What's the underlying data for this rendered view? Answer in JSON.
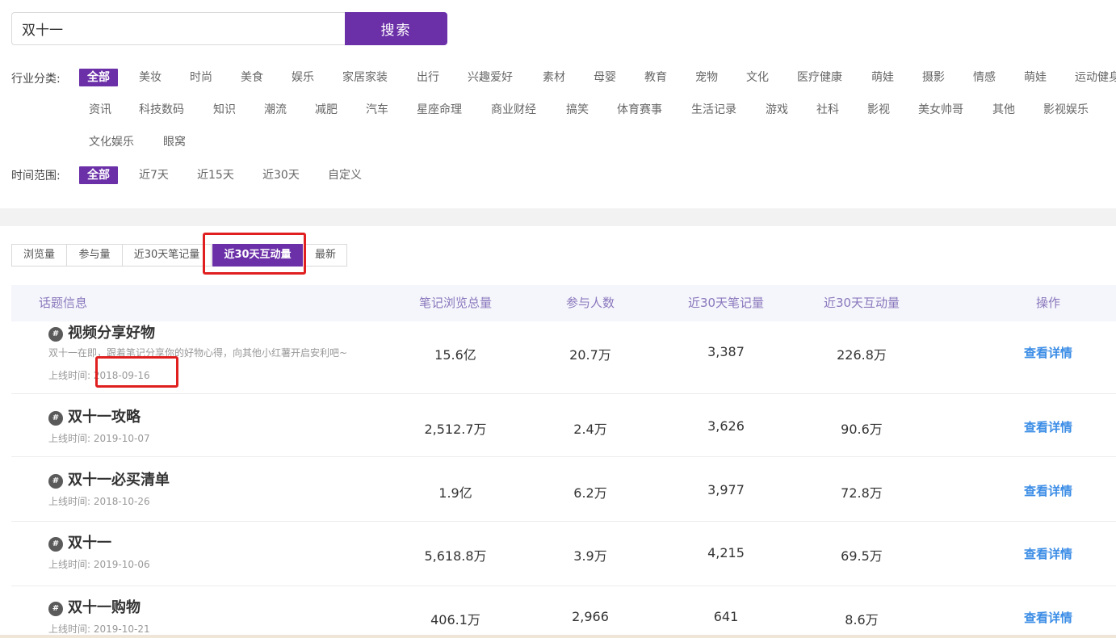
{
  "search": {
    "value": "双十一",
    "button_label": "搜索"
  },
  "filters": {
    "industry": {
      "label": "行业分类:",
      "items": [
        {
          "label": "全部",
          "active": true
        },
        {
          "label": "美妆"
        },
        {
          "label": "时尚"
        },
        {
          "label": "美食"
        },
        {
          "label": "娱乐"
        },
        {
          "label": "家居家装"
        },
        {
          "label": "出行"
        },
        {
          "label": "兴趣爱好"
        },
        {
          "label": "素材"
        },
        {
          "label": "母婴"
        },
        {
          "label": "教育"
        },
        {
          "label": "宠物"
        },
        {
          "label": "文化"
        },
        {
          "label": "医疗健康"
        },
        {
          "label": "萌娃"
        },
        {
          "label": "摄影"
        },
        {
          "label": "情感"
        },
        {
          "label": "萌娃"
        },
        {
          "label": "运动健身"
        },
        {
          "label": "资讯"
        },
        {
          "label": "科技数码"
        },
        {
          "label": "知识"
        },
        {
          "label": "潮流"
        },
        {
          "label": "减肥"
        },
        {
          "label": "汽车"
        },
        {
          "label": "星座命理"
        },
        {
          "label": "商业财经"
        },
        {
          "label": "搞笑"
        },
        {
          "label": "体育赛事"
        },
        {
          "label": "生活记录"
        },
        {
          "label": "游戏"
        },
        {
          "label": "社科"
        },
        {
          "label": "影视"
        },
        {
          "label": "美女帅哥"
        },
        {
          "label": "其他"
        },
        {
          "label": "影视娱乐"
        },
        {
          "label": "文化娱乐"
        },
        {
          "label": "眼窝"
        }
      ]
    },
    "time_range": {
      "label": "时间范围:",
      "items": [
        {
          "label": "全部",
          "active": true
        },
        {
          "label": "近7天"
        },
        {
          "label": "近15天"
        },
        {
          "label": "近30天"
        },
        {
          "label": "自定义"
        }
      ]
    }
  },
  "sort_tabs": [
    {
      "label": "浏览量"
    },
    {
      "label": "参与量"
    },
    {
      "label": "近30天笔记量"
    },
    {
      "label": "近30天互动量",
      "active": true
    },
    {
      "label": "最新"
    }
  ],
  "table": {
    "headers": {
      "topic": "话题信息",
      "views": "笔记浏览总量",
      "participants": "参与人数",
      "notes_30d": "近30天笔记量",
      "interactions_30d": "近30天互动量",
      "action": "操作"
    },
    "time_prefix": "上线时间:",
    "rows": [
      {
        "title": "视频分享好物",
        "desc": "双十一在即，跟着笔记分享你的好物心得，向其他小红薯开启安利吧~",
        "date": "2018-09-16",
        "views": "15.6亿",
        "participants": "20.7万",
        "notes_30d": "3,387",
        "interactions_30d": "226.8万",
        "action": "查看详情"
      },
      {
        "title": "双十一攻略",
        "date": "2019-10-07",
        "views": "2,512.7万",
        "participants": "2.4万",
        "notes_30d": "3,626",
        "interactions_30d": "90.6万",
        "action": "查看详情"
      },
      {
        "title": "双十一必买清单",
        "date": "2018-10-26",
        "views": "1.9亿",
        "participants": "6.2万",
        "notes_30d": "3,977",
        "interactions_30d": "72.8万",
        "action": "查看详情"
      },
      {
        "title": "双十一",
        "date": "2019-10-06",
        "views": "5,618.8万",
        "participants": "3.9万",
        "notes_30d": "4,215",
        "interactions_30d": "69.5万",
        "action": "查看详情"
      },
      {
        "title": "双十一购物",
        "date": "2019-10-21",
        "views": "406.1万",
        "participants": "2,966",
        "notes_30d": "641",
        "interactions_30d": "8.6万",
        "action": "查看详情"
      }
    ]
  },
  "colors": {
    "accent": "#6b2fa8",
    "link": "#3c8de6",
    "highlight": "#e02020"
  }
}
